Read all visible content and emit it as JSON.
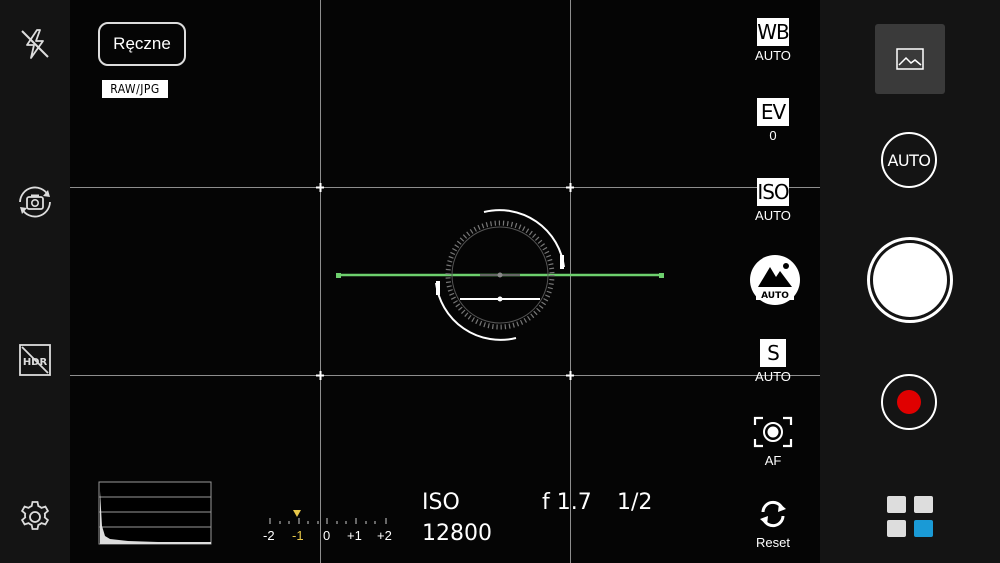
{
  "app": {
    "mode_label": "Ręczne",
    "format_label": "RAW/JPG"
  },
  "left_toolbar": {
    "flash": {
      "icon": "flash-off-icon"
    },
    "camera_switch": {
      "icon": "camera-switch-icon"
    },
    "hdr": {
      "icon": "hdr-off-icon",
      "label": "HDR"
    },
    "settings": {
      "icon": "gear-icon"
    }
  },
  "manual_controls": {
    "wb": {
      "label": "WB",
      "value": "AUTO"
    },
    "ev": {
      "label": "EV",
      "value": "0"
    },
    "iso": {
      "label": "ISO",
      "value": "AUTO"
    },
    "scene": {
      "label": "AUTO",
      "icon": "scene-auto-icon"
    },
    "shutter": {
      "label": "S",
      "value": "AUTO"
    },
    "focus": {
      "label": "AF",
      "icon": "focus-icon"
    },
    "reset": {
      "label": "Reset",
      "icon": "reset-icon"
    }
  },
  "readouts": {
    "iso_label": "ISO",
    "iso_value": "12800",
    "aperture": "f 1.7",
    "shutter_speed": "1/2"
  },
  "exposure_scale": {
    "labels": [
      "-2",
      "-1",
      "0",
      "+1",
      "+2"
    ],
    "current": "-1",
    "marker_color": "#e8c84a"
  },
  "right_panel": {
    "gallery": {
      "icon": "gallery-icon"
    },
    "auto_mode": {
      "label": "AUTO"
    },
    "shutter": {
      "icon": "shutter-button"
    },
    "record": {
      "icon": "record-icon",
      "color": "#e00000"
    },
    "modes": {
      "icon": "mode-grid-icon",
      "accent": "#1a9ad6"
    }
  },
  "colors": {
    "level_line": "#6ed06e"
  }
}
